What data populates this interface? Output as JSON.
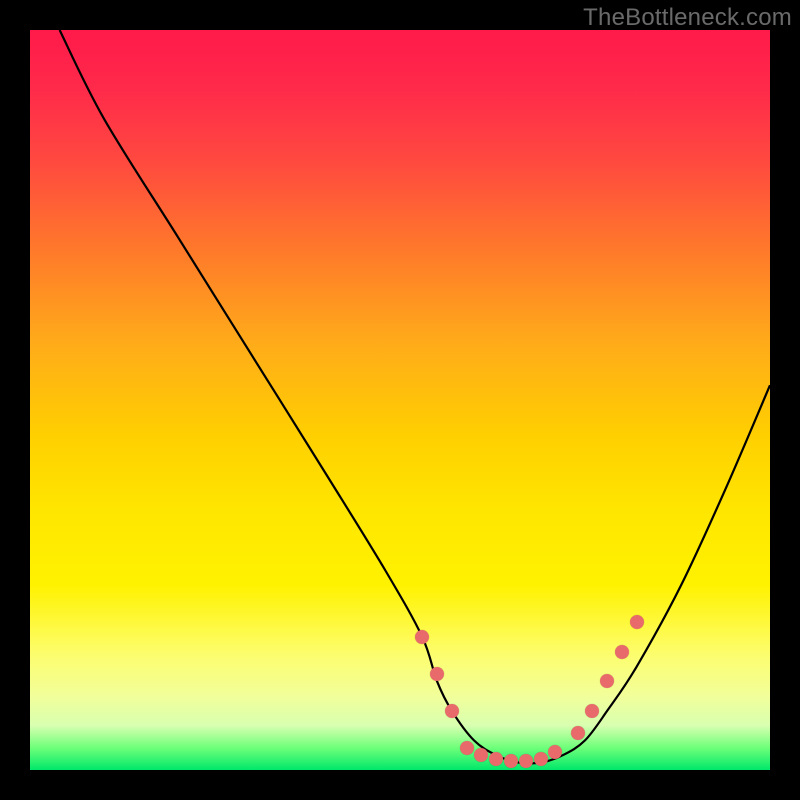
{
  "watermark": "TheBottleneck.com",
  "colors": {
    "background": "#000000",
    "dot": "#e86a6a",
    "curve": "#000000"
  },
  "chart_data": {
    "type": "line",
    "title": "",
    "xlabel": "",
    "ylabel": "",
    "xlim": [
      0,
      100
    ],
    "ylim": [
      0,
      100
    ],
    "grid": false,
    "legend": false,
    "series": [
      {
        "name": "bottleneck-curve",
        "x": [
          4,
          10,
          20,
          30,
          40,
          48,
          53,
          55,
          57,
          60,
          63,
          66,
          69,
          72,
          75,
          78,
          82,
          88,
          94,
          100
        ],
        "y": [
          100,
          88,
          72,
          56,
          40,
          27,
          18,
          12,
          8,
          4,
          2,
          1,
          1,
          2,
          4,
          8,
          14,
          25,
          38,
          52
        ]
      }
    ],
    "points": [
      {
        "name": "left-cluster-1",
        "x": 53,
        "y": 18
      },
      {
        "name": "left-cluster-2",
        "x": 55,
        "y": 13
      },
      {
        "name": "left-cluster-3",
        "x": 57,
        "y": 8
      },
      {
        "name": "valley-1",
        "x": 59,
        "y": 3
      },
      {
        "name": "valley-2",
        "x": 61,
        "y": 2
      },
      {
        "name": "valley-3",
        "x": 63,
        "y": 1.5
      },
      {
        "name": "valley-4",
        "x": 65,
        "y": 1.2
      },
      {
        "name": "valley-5",
        "x": 67,
        "y": 1.2
      },
      {
        "name": "valley-6",
        "x": 69,
        "y": 1.5
      },
      {
        "name": "valley-7",
        "x": 71,
        "y": 2.5
      },
      {
        "name": "right-cluster-1",
        "x": 74,
        "y": 5
      },
      {
        "name": "right-cluster-2",
        "x": 76,
        "y": 8
      },
      {
        "name": "right-cluster-3",
        "x": 78,
        "y": 12
      },
      {
        "name": "right-cluster-4",
        "x": 80,
        "y": 16
      },
      {
        "name": "right-cluster-5",
        "x": 82,
        "y": 20
      }
    ]
  }
}
